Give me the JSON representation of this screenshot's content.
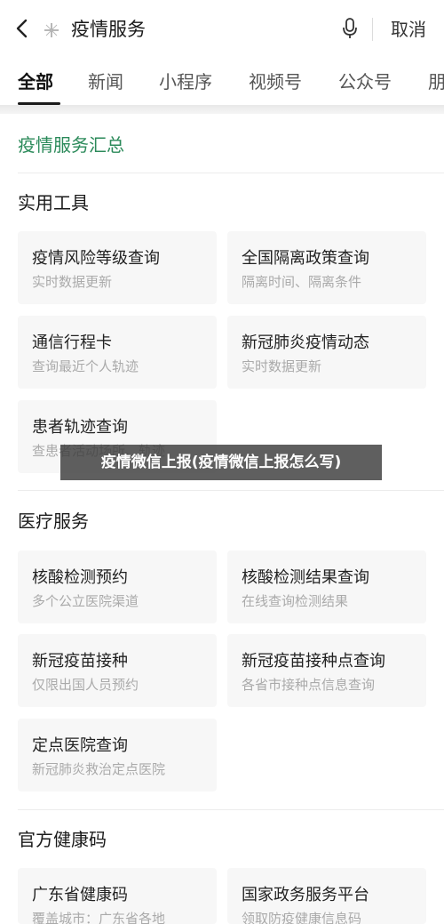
{
  "search": {
    "query": "疫情服务",
    "cancel_label": "取消"
  },
  "tabs": [
    "全部",
    "新闻",
    "小程序",
    "视频号",
    "公众号",
    "朋"
  ],
  "summary_title": "疫情服务汇总",
  "sections": [
    {
      "title": "实用工具",
      "cards": [
        {
          "title": "疫情风险等级查询",
          "subtitle": "实时数据更新"
        },
        {
          "title": "全国隔离政策查询",
          "subtitle": "隔离时间、隔离条件"
        },
        {
          "title": "通信行程卡",
          "subtitle": "查询最近个人轨迹"
        },
        {
          "title": "新冠肺炎疫情动态",
          "subtitle": "实时数据更新"
        },
        {
          "title": "患者轨迹查询",
          "subtitle": "查患者活动场所、轨迹"
        }
      ]
    },
    {
      "title": "医疗服务",
      "cards": [
        {
          "title": "核酸检测预约",
          "subtitle": "多个公立医院渠道"
        },
        {
          "title": "核酸检测结果查询",
          "subtitle": "在线查询检测结果"
        },
        {
          "title": "新冠疫苗接种",
          "subtitle": "仅限出国人员预约"
        },
        {
          "title": "新冠疫苗接种点查询",
          "subtitle": "各省市接种点信息查询"
        },
        {
          "title": "定点医院查询",
          "subtitle": "新冠肺炎救治定点医院"
        }
      ]
    },
    {
      "title": "官方健康码",
      "cards": [
        {
          "title": "广东省健康码",
          "subtitle": "覆盖城市：广东省各地"
        },
        {
          "title": "国家政务服务平台",
          "subtitle": "领取防疫健康信息码"
        }
      ]
    }
  ],
  "overlay_caption": "疫情微信上报(疫情微信上报怎么写)"
}
